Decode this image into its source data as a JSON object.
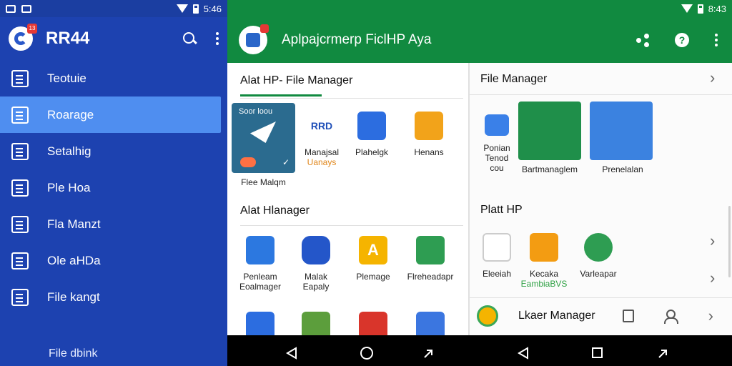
{
  "status_left": {
    "time": "5:46"
  },
  "status_right": {
    "time": "8:43"
  },
  "drawer": {
    "title": "RR44",
    "badge": "13",
    "items": [
      {
        "label": "Teotuie",
        "active": false
      },
      {
        "label": "Roarage",
        "active": true
      },
      {
        "label": "Setalhig",
        "active": false
      },
      {
        "label": "Ple Hoa",
        "active": false
      },
      {
        "label": "Fla Manzt",
        "active": false
      },
      {
        "label": "Ole aHDa",
        "active": false
      },
      {
        "label": "File kangt",
        "active": false
      }
    ],
    "footer": "File dbink"
  },
  "appbar": {
    "title": "Aplpajcrmerp FiclHP Aya"
  },
  "left_panel": {
    "section1_title": "Alat HP- File Manager",
    "featured": {
      "top_text": "Soor loou",
      "label": "Flee Malqm"
    },
    "row1": [
      {
        "line1": "Manajsal",
        "line2": "Uanays",
        "logo": "RRD",
        "color": "#1f4fb8"
      },
      {
        "line1": "Plahelgk",
        "line2": "",
        "color": "#2c6de0"
      },
      {
        "line1": "Henans",
        "line2": "",
        "color": "#f2a31a"
      }
    ],
    "section2_title": "Alat Hlanager",
    "row2": [
      {
        "line1": "Penleam",
        "line2": "Eoalmager",
        "color": "#2c78e0"
      },
      {
        "line1": "Malak",
        "line2": "Eapaly",
        "color": "#2456c9"
      },
      {
        "line1": "Plemage",
        "line2": "",
        "color": "#f5b400"
      },
      {
        "line1": "Flreheadapr",
        "line2": "",
        "color": "#2e9d52"
      }
    ],
    "row3_colors": [
      "#2c6de0",
      "#5c9e3c",
      "#d9352b",
      "#3b76e0"
    ]
  },
  "right_panel": {
    "header": "File Manager",
    "row1": [
      {
        "line1": "Ponian",
        "line2": "Tenod",
        "line3": "cou",
        "color": "#3a80e8"
      },
      {
        "line1": "Bartmanaglem",
        "color": "#1f8f4a"
      },
      {
        "line1": "Prenelalan",
        "color": "#3b82e0"
      }
    ],
    "section2_title": "Platt HP",
    "row2": [
      {
        "line1": "Eleeiah",
        "line2": "",
        "color": "#2f6fd8"
      },
      {
        "line1": "Kecaka",
        "line2": "EambiaBVS",
        "color": "#f39c12"
      },
      {
        "line1": "Varleapar",
        "line2": "",
        "color": "#2e9d52"
      }
    ],
    "list_row_label": "Lkaer Manager"
  }
}
